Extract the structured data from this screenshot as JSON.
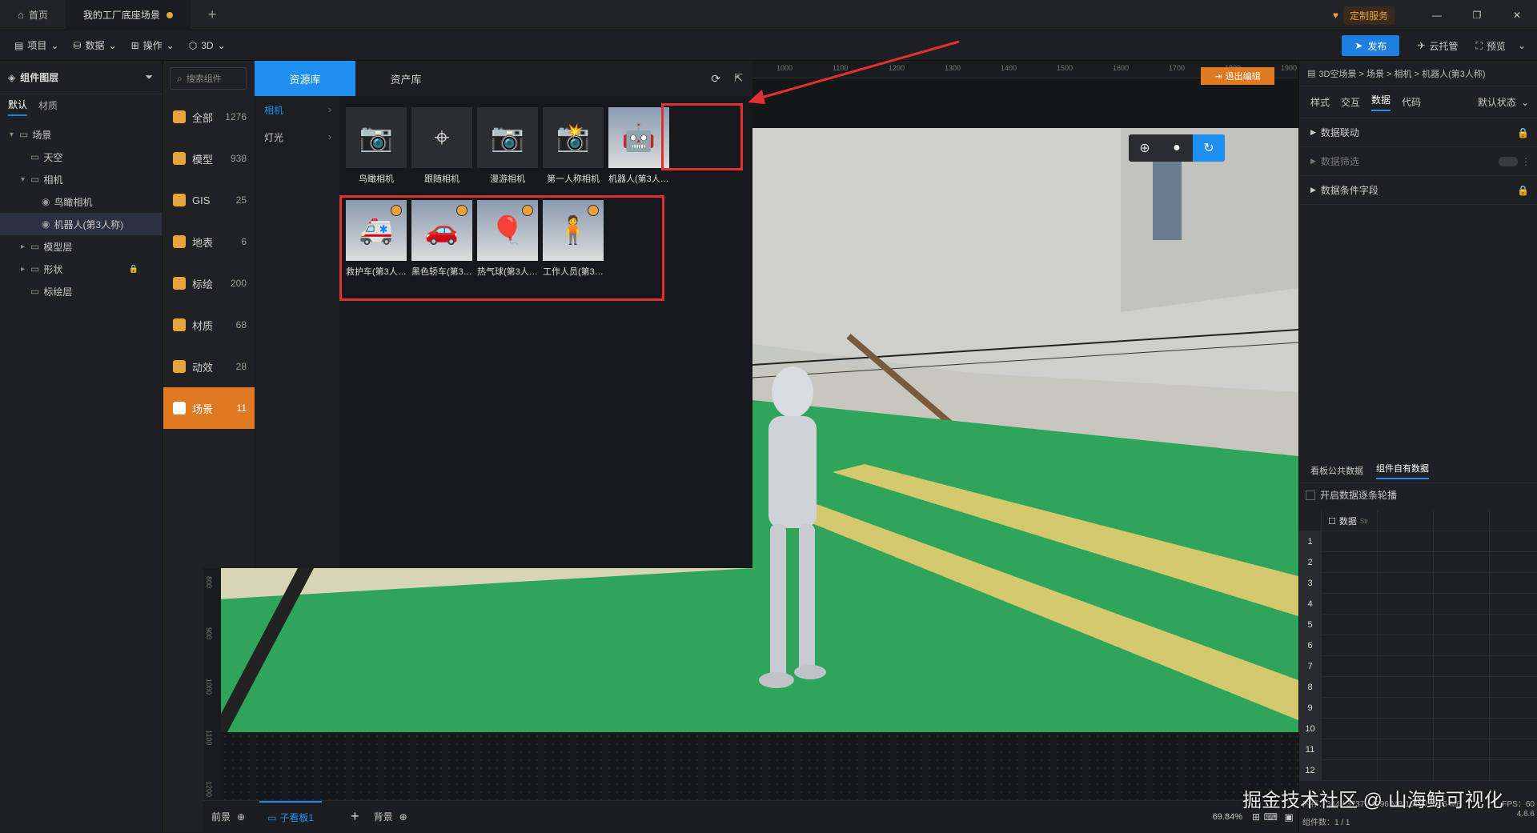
{
  "titlebar": {
    "home_tab": "首页",
    "scene_tab": "我的工厂底座场景",
    "add_tab": "+",
    "custom_service": "定制服务",
    "win_min": "—",
    "win_max": "❐",
    "win_close": "✕"
  },
  "toolbar": {
    "items": [
      "项目",
      "数据",
      "操作",
      "3D"
    ],
    "publish": "发布",
    "cloud": "云托管",
    "preview": "预览"
  },
  "left": {
    "title": "组件图层",
    "tabs": [
      "默认",
      "材质"
    ],
    "tree": [
      {
        "label": "场景",
        "indent": 0,
        "arrow": "▾"
      },
      {
        "label": "天空",
        "indent": 1,
        "arrow": ""
      },
      {
        "label": "相机",
        "indent": 1,
        "arrow": "▾"
      },
      {
        "label": "鸟瞰相机",
        "indent": 2,
        "arrow": ""
      },
      {
        "label": "机器人(第3人称)",
        "indent": 2,
        "arrow": ""
      },
      {
        "label": "模型层",
        "indent": 1,
        "arrow": "▸"
      },
      {
        "label": "形状",
        "indent": 1,
        "arrow": "▸"
      },
      {
        "label": "标绘层",
        "indent": 1,
        "arrow": ""
      }
    ]
  },
  "library": {
    "search_placeholder": "搜索组件",
    "tab_resource": "资源库",
    "tab_asset": "资产库",
    "categories": [
      {
        "label": "全部",
        "count": "1276",
        "color": "#e9a23b"
      },
      {
        "label": "模型",
        "count": "938",
        "color": "#e9a23b"
      },
      {
        "label": "GIS",
        "count": "25",
        "color": "#e9a23b"
      },
      {
        "label": "地表",
        "count": "6",
        "color": "#e9a23b"
      },
      {
        "label": "标绘",
        "count": "200",
        "color": "#e9a23b"
      },
      {
        "label": "材质",
        "count": "68",
        "color": "#e9a23b"
      },
      {
        "label": "动效",
        "count": "28",
        "color": "#e9a23b"
      },
      {
        "label": "场景",
        "count": "11",
        "color": "#ffffff"
      }
    ],
    "subcats": [
      "相机",
      "灯光"
    ],
    "cards": [
      {
        "label": "鸟瞰相机",
        "glyph": "📷"
      },
      {
        "label": "跟随相机",
        "glyph": "⌖"
      },
      {
        "label": "漫游相机",
        "glyph": "📷"
      },
      {
        "label": "第一人称相机",
        "glyph": "📸"
      },
      {
        "label": "机器人(第3人称)",
        "glyph": "🤖"
      },
      {
        "label": "救护车(第3人称)",
        "glyph": "🚑"
      },
      {
        "label": "黑色轿车(第3人...",
        "glyph": "🚗"
      },
      {
        "label": "热气球(第3人称)",
        "glyph": "🎈"
      },
      {
        "label": "工作人员(第3人...",
        "glyph": "🧍"
      }
    ]
  },
  "viewport": {
    "exit_edit": "退出编辑",
    "ruler_top": [
      "1000",
      "1100",
      "1200",
      "1300",
      "1400",
      "1500",
      "1600",
      "1700",
      "1800",
      "1900"
    ],
    "ruler_left": [
      "800",
      "900",
      "1000",
      "1100",
      "1200"
    ],
    "bottom": {
      "front": "前景",
      "sub": "子看板1",
      "add": "+",
      "back": "背景",
      "zoom": "69.84%"
    }
  },
  "right": {
    "breadcrumb": "3D空场景 > 场景 > 相机 > 机器人(第3人称)",
    "tabs": [
      "样式",
      "交互",
      "数据",
      "代码"
    ],
    "state": "默认状态",
    "sections": [
      "数据联动",
      "数据筛选",
      "数据条件字段"
    ],
    "data_tabs": [
      "看板公共数据",
      "组件自有数据"
    ],
    "carousel": "开启数据逐条轮播",
    "grid_header": "数据",
    "grid_type": "Str",
    "rows": [
      "1",
      "2",
      "3",
      "4",
      "5",
      "6",
      "7",
      "8",
      "9",
      "10",
      "11",
      "12"
    ],
    "status_fps": "FPS：60",
    "status_mem": "内存：344 / 3737 / 4096 MB  1617 / 3505 MB",
    "status_count": "组件数：1 / 1",
    "version": "4.6.6"
  },
  "watermark": "掘金技术社区 @ 山海鲸可视化"
}
